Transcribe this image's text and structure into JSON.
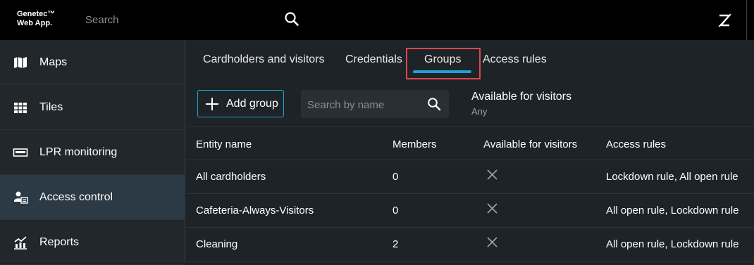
{
  "app": {
    "logo_line1": "Genetec™",
    "logo_line2": "Web App."
  },
  "topbar": {
    "search_placeholder": "Search"
  },
  "sidebar": {
    "items": [
      {
        "label": "Maps",
        "icon": "map-icon"
      },
      {
        "label": "Tiles",
        "icon": "tiles-grid-icon"
      },
      {
        "label": "LPR monitoring",
        "icon": "license-plate-icon"
      },
      {
        "label": "Access control",
        "icon": "access-control-icon",
        "active": true
      },
      {
        "label": "Reports",
        "icon": "reports-chart-icon"
      }
    ]
  },
  "tabs": [
    {
      "label": "Cardholders and visitors"
    },
    {
      "label": "Credentials"
    },
    {
      "label": "Groups",
      "active": true
    },
    {
      "label": "Access rules"
    }
  ],
  "toolbar": {
    "add_label": "Add group",
    "search_placeholder": "Search by name",
    "filter_title": "Available for visitors",
    "filter_value": "Any"
  },
  "table": {
    "columns": [
      "Entity name",
      "Members",
      "Available for visitors",
      "Access rules"
    ],
    "rows": [
      {
        "name": "All cardholders",
        "members": "0",
        "available": false,
        "rules": "Lockdown rule, All open rule"
      },
      {
        "name": "Cafeteria-Always-Visitors",
        "members": "0",
        "available": false,
        "rules": "All open rule, Lockdown rule"
      },
      {
        "name": "Cleaning",
        "members": "2",
        "available": false,
        "rules": "All open rule, Lockdown rule"
      }
    ]
  },
  "colors": {
    "accent": "#1fa2d6",
    "highlight_box": "#e0474c",
    "active_sidebar": "#2b3a44"
  }
}
